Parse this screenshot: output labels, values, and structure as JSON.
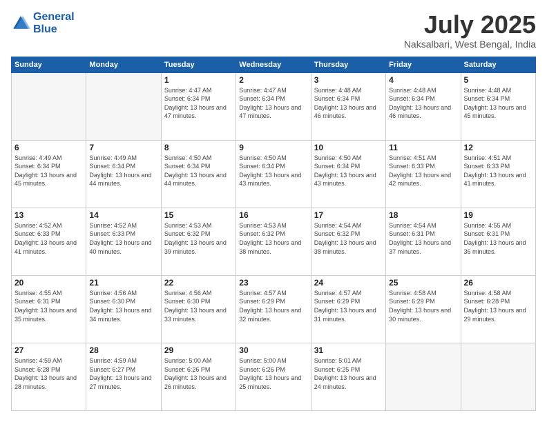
{
  "header": {
    "logo_line1": "General",
    "logo_line2": "Blue",
    "title": "July 2025",
    "subtitle": "Naksalbari, West Bengal, India"
  },
  "calendar": {
    "headers": [
      "Sunday",
      "Monday",
      "Tuesday",
      "Wednesday",
      "Thursday",
      "Friday",
      "Saturday"
    ],
    "rows": [
      [
        {
          "day": "",
          "sunrise": "",
          "sunset": "",
          "daylight": "",
          "empty": true
        },
        {
          "day": "",
          "sunrise": "",
          "sunset": "",
          "daylight": "",
          "empty": true
        },
        {
          "day": "1",
          "sunrise": "Sunrise: 4:47 AM",
          "sunset": "Sunset: 6:34 PM",
          "daylight": "Daylight: 13 hours and 47 minutes.",
          "empty": false
        },
        {
          "day": "2",
          "sunrise": "Sunrise: 4:47 AM",
          "sunset": "Sunset: 6:34 PM",
          "daylight": "Daylight: 13 hours and 47 minutes.",
          "empty": false
        },
        {
          "day": "3",
          "sunrise": "Sunrise: 4:48 AM",
          "sunset": "Sunset: 6:34 PM",
          "daylight": "Daylight: 13 hours and 46 minutes.",
          "empty": false
        },
        {
          "day": "4",
          "sunrise": "Sunrise: 4:48 AM",
          "sunset": "Sunset: 6:34 PM",
          "daylight": "Daylight: 13 hours and 46 minutes.",
          "empty": false
        },
        {
          "day": "5",
          "sunrise": "Sunrise: 4:48 AM",
          "sunset": "Sunset: 6:34 PM",
          "daylight": "Daylight: 13 hours and 45 minutes.",
          "empty": false
        }
      ],
      [
        {
          "day": "6",
          "sunrise": "Sunrise: 4:49 AM",
          "sunset": "Sunset: 6:34 PM",
          "daylight": "Daylight: 13 hours and 45 minutes.",
          "empty": false
        },
        {
          "day": "7",
          "sunrise": "Sunrise: 4:49 AM",
          "sunset": "Sunset: 6:34 PM",
          "daylight": "Daylight: 13 hours and 44 minutes.",
          "empty": false
        },
        {
          "day": "8",
          "sunrise": "Sunrise: 4:50 AM",
          "sunset": "Sunset: 6:34 PM",
          "daylight": "Daylight: 13 hours and 44 minutes.",
          "empty": false
        },
        {
          "day": "9",
          "sunrise": "Sunrise: 4:50 AM",
          "sunset": "Sunset: 6:34 PM",
          "daylight": "Daylight: 13 hours and 43 minutes.",
          "empty": false
        },
        {
          "day": "10",
          "sunrise": "Sunrise: 4:50 AM",
          "sunset": "Sunset: 6:34 PM",
          "daylight": "Daylight: 13 hours and 43 minutes.",
          "empty": false
        },
        {
          "day": "11",
          "sunrise": "Sunrise: 4:51 AM",
          "sunset": "Sunset: 6:33 PM",
          "daylight": "Daylight: 13 hours and 42 minutes.",
          "empty": false
        },
        {
          "day": "12",
          "sunrise": "Sunrise: 4:51 AM",
          "sunset": "Sunset: 6:33 PM",
          "daylight": "Daylight: 13 hours and 41 minutes.",
          "empty": false
        }
      ],
      [
        {
          "day": "13",
          "sunrise": "Sunrise: 4:52 AM",
          "sunset": "Sunset: 6:33 PM",
          "daylight": "Daylight: 13 hours and 41 minutes.",
          "empty": false
        },
        {
          "day": "14",
          "sunrise": "Sunrise: 4:52 AM",
          "sunset": "Sunset: 6:33 PM",
          "daylight": "Daylight: 13 hours and 40 minutes.",
          "empty": false
        },
        {
          "day": "15",
          "sunrise": "Sunrise: 4:53 AM",
          "sunset": "Sunset: 6:32 PM",
          "daylight": "Daylight: 13 hours and 39 minutes.",
          "empty": false
        },
        {
          "day": "16",
          "sunrise": "Sunrise: 4:53 AM",
          "sunset": "Sunset: 6:32 PM",
          "daylight": "Daylight: 13 hours and 38 minutes.",
          "empty": false
        },
        {
          "day": "17",
          "sunrise": "Sunrise: 4:54 AM",
          "sunset": "Sunset: 6:32 PM",
          "daylight": "Daylight: 13 hours and 38 minutes.",
          "empty": false
        },
        {
          "day": "18",
          "sunrise": "Sunrise: 4:54 AM",
          "sunset": "Sunset: 6:31 PM",
          "daylight": "Daylight: 13 hours and 37 minutes.",
          "empty": false
        },
        {
          "day": "19",
          "sunrise": "Sunrise: 4:55 AM",
          "sunset": "Sunset: 6:31 PM",
          "daylight": "Daylight: 13 hours and 36 minutes.",
          "empty": false
        }
      ],
      [
        {
          "day": "20",
          "sunrise": "Sunrise: 4:55 AM",
          "sunset": "Sunset: 6:31 PM",
          "daylight": "Daylight: 13 hours and 35 minutes.",
          "empty": false
        },
        {
          "day": "21",
          "sunrise": "Sunrise: 4:56 AM",
          "sunset": "Sunset: 6:30 PM",
          "daylight": "Daylight: 13 hours and 34 minutes.",
          "empty": false
        },
        {
          "day": "22",
          "sunrise": "Sunrise: 4:56 AM",
          "sunset": "Sunset: 6:30 PM",
          "daylight": "Daylight: 13 hours and 33 minutes.",
          "empty": false
        },
        {
          "day": "23",
          "sunrise": "Sunrise: 4:57 AM",
          "sunset": "Sunset: 6:29 PM",
          "daylight": "Daylight: 13 hours and 32 minutes.",
          "empty": false
        },
        {
          "day": "24",
          "sunrise": "Sunrise: 4:57 AM",
          "sunset": "Sunset: 6:29 PM",
          "daylight": "Daylight: 13 hours and 31 minutes.",
          "empty": false
        },
        {
          "day": "25",
          "sunrise": "Sunrise: 4:58 AM",
          "sunset": "Sunset: 6:29 PM",
          "daylight": "Daylight: 13 hours and 30 minutes.",
          "empty": false
        },
        {
          "day": "26",
          "sunrise": "Sunrise: 4:58 AM",
          "sunset": "Sunset: 6:28 PM",
          "daylight": "Daylight: 13 hours and 29 minutes.",
          "empty": false
        }
      ],
      [
        {
          "day": "27",
          "sunrise": "Sunrise: 4:59 AM",
          "sunset": "Sunset: 6:28 PM",
          "daylight": "Daylight: 13 hours and 28 minutes.",
          "empty": false
        },
        {
          "day": "28",
          "sunrise": "Sunrise: 4:59 AM",
          "sunset": "Sunset: 6:27 PM",
          "daylight": "Daylight: 13 hours and 27 minutes.",
          "empty": false
        },
        {
          "day": "29",
          "sunrise": "Sunrise: 5:00 AM",
          "sunset": "Sunset: 6:26 PM",
          "daylight": "Daylight: 13 hours and 26 minutes.",
          "empty": false
        },
        {
          "day": "30",
          "sunrise": "Sunrise: 5:00 AM",
          "sunset": "Sunset: 6:26 PM",
          "daylight": "Daylight: 13 hours and 25 minutes.",
          "empty": false
        },
        {
          "day": "31",
          "sunrise": "Sunrise: 5:01 AM",
          "sunset": "Sunset: 6:25 PM",
          "daylight": "Daylight: 13 hours and 24 minutes.",
          "empty": false
        },
        {
          "day": "",
          "sunrise": "",
          "sunset": "",
          "daylight": "",
          "empty": true
        },
        {
          "day": "",
          "sunrise": "",
          "sunset": "",
          "daylight": "",
          "empty": true
        }
      ]
    ]
  }
}
